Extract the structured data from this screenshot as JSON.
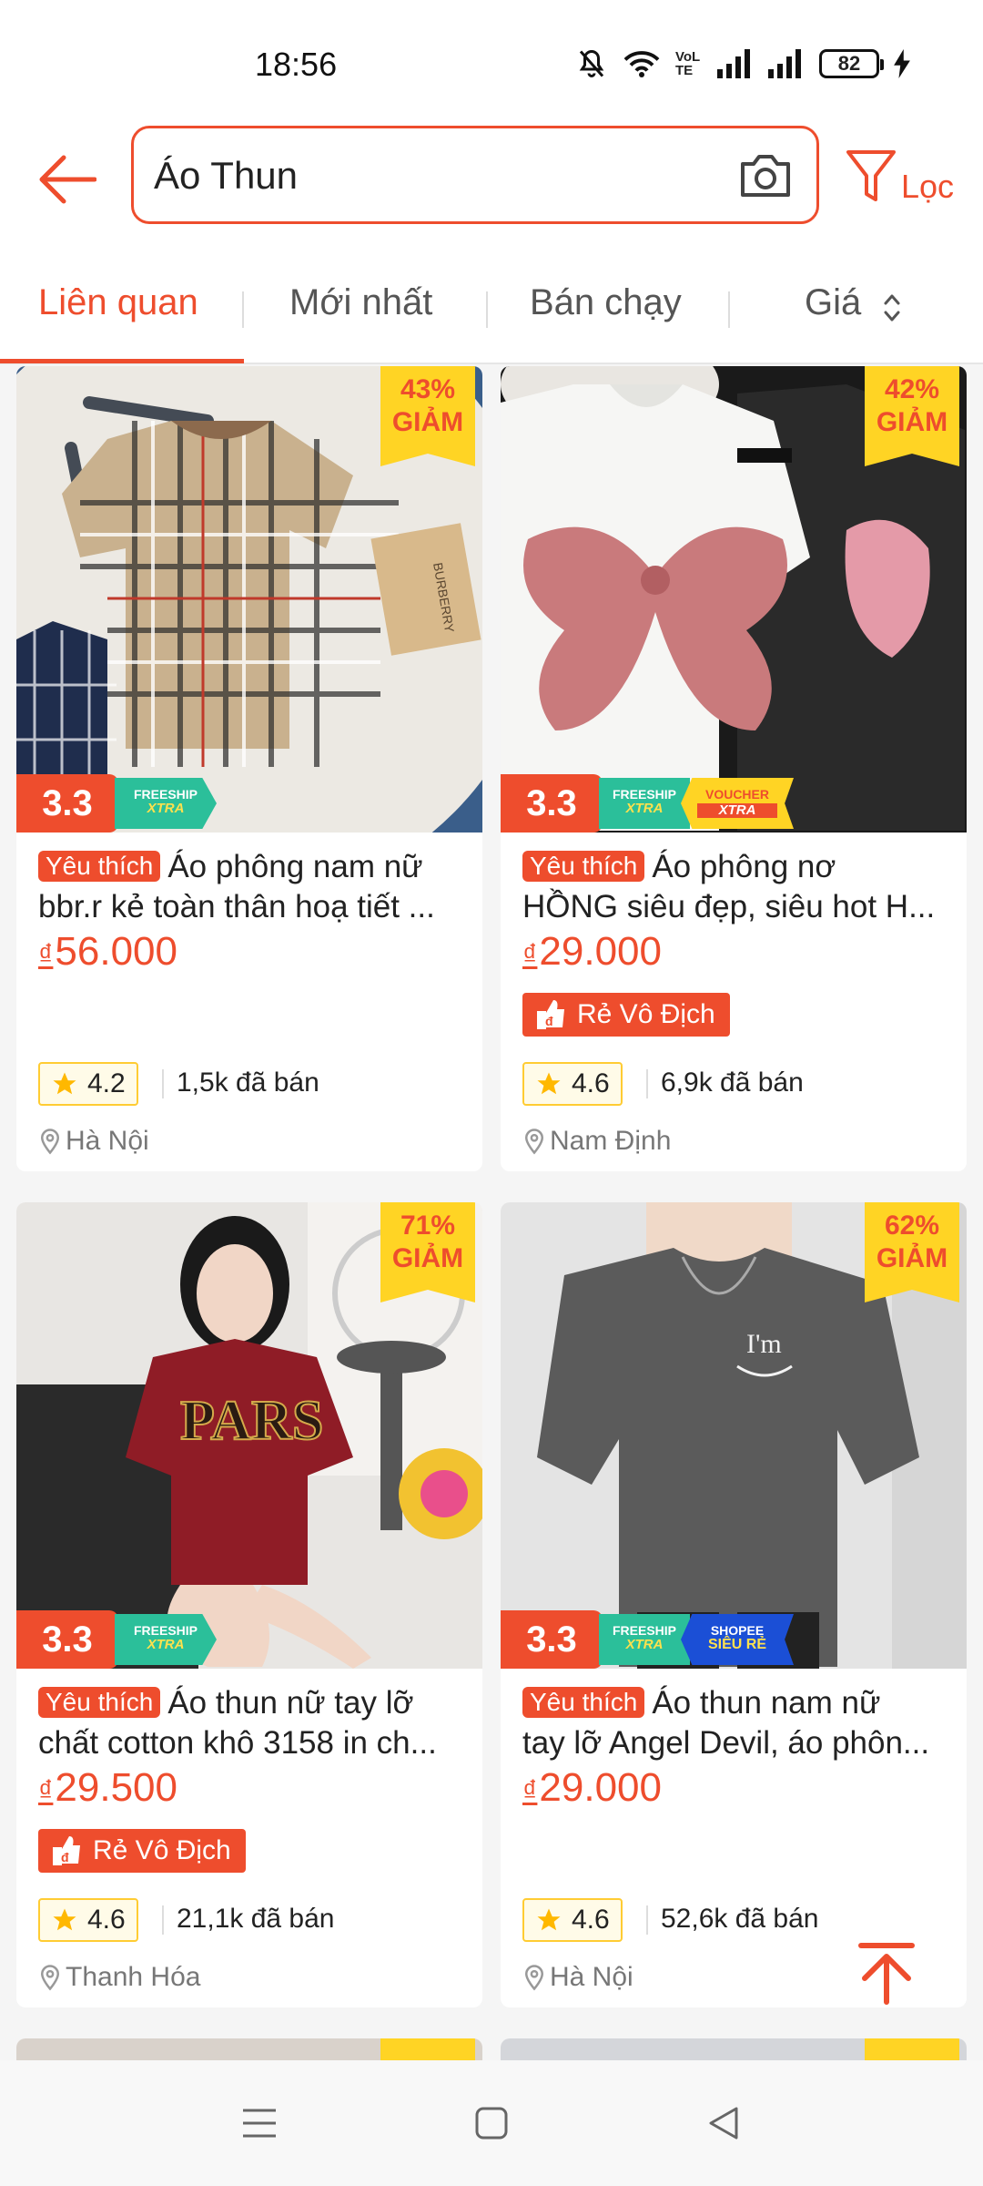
{
  "status_bar": {
    "time": "18:56",
    "battery": "82",
    "network": "VoLTE"
  },
  "header": {
    "search_value": "Áo Thun",
    "filter_label": "Lọc"
  },
  "sort_tabs": [
    {
      "label": "Liên quan",
      "active": true
    },
    {
      "label": "Mới nhất",
      "active": false
    },
    {
      "label": "Bán chạy",
      "active": false
    },
    {
      "label": "Giá",
      "active": false
    }
  ],
  "products": [
    {
      "discount": "43%",
      "discount_word": "GIẢM",
      "promo": {
        "main": "3.3",
        "freeship": "FREESHIP",
        "xtra": "XTRA"
      },
      "fav": "Yêu thích",
      "title_line1": "Áo phông nam nữ",
      "title_line2": "bbr.r kẻ toàn thân hoạ tiết ...",
      "currency": "₫",
      "price": "56.000",
      "rating": "4.2",
      "sold": "1,5k đã bán",
      "location": "Hà Nội"
    },
    {
      "discount": "42%",
      "discount_word": "GIẢM",
      "promo": {
        "main": "3.3",
        "freeship": "FREESHIP",
        "xtra": "XTRA",
        "voucher": "VOUCHER",
        "voucher_xtra": "XTRA"
      },
      "fav": "Yêu thích",
      "title_line1": "Áo phông nơ",
      "title_line2": "HỒNG siêu đẹp, siêu hot H...",
      "currency": "₫",
      "price": "29.000",
      "cheap_badge": "Rẻ Vô Địch",
      "rating": "4.6",
      "sold": "6,9k đã bán",
      "location": "Nam Định"
    },
    {
      "discount": "71%",
      "discount_word": "GIẢM",
      "promo": {
        "main": "3.3",
        "freeship": "FREESHIP",
        "xtra": "XTRA"
      },
      "fav": "Yêu thích",
      "title_line1": "Áo thun nữ tay lỡ",
      "title_line2": "chất cotton khô 3158 in ch...",
      "currency": "₫",
      "price": "29.500",
      "cheap_badge": "Rẻ Vô Địch",
      "rating": "4.6",
      "sold": "21,1k đã bán",
      "location": "Thanh Hóa"
    },
    {
      "discount": "62%",
      "discount_word": "GIẢM",
      "promo": {
        "main": "3.3",
        "freeship": "FREESHIP",
        "xtra": "XTRA",
        "shopee": "SHOPEE",
        "sieure": "SIÊU RẺ"
      },
      "fav": "Yêu thích",
      "title_line1": "Áo thun nam nữ",
      "title_line2": "tay lỡ Angel Devil, áo phôn...",
      "currency": "₫",
      "price": "29.000",
      "rating": "4.6",
      "sold": "52,6k đã bán",
      "location": "Hà Nội"
    }
  ],
  "colors": {
    "accent": "#ee4d2d",
    "discount_bg": "#ffd424",
    "freeship": "#2bbf9a",
    "sieure": "#1b4fd6"
  }
}
